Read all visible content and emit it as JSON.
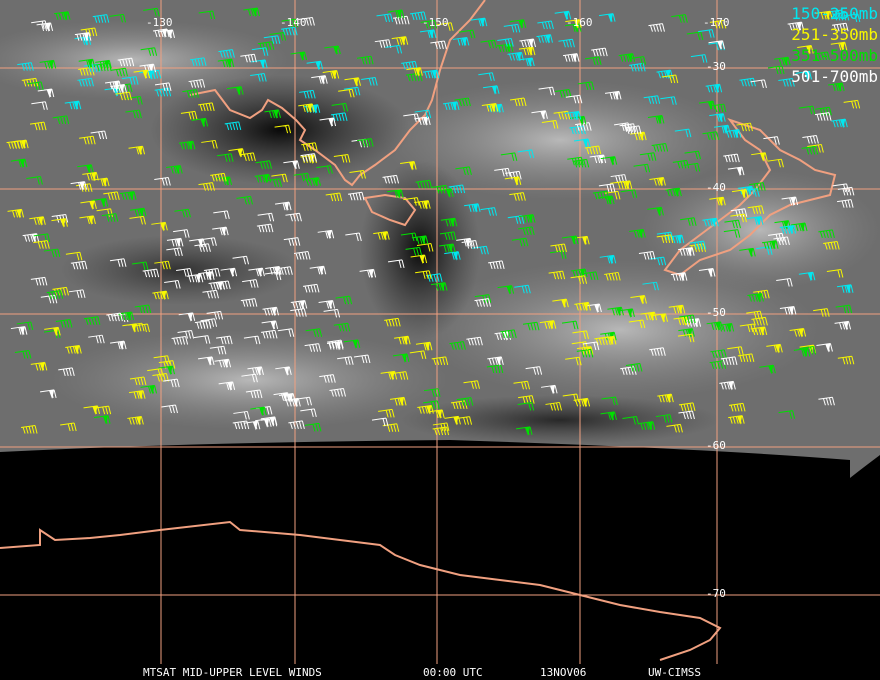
{
  "map": {
    "lon_labels": [
      "-130",
      "-140",
      "-150",
      "-160",
      "-170"
    ],
    "lat_labels": [
      "-30",
      "-40",
      "-50",
      "-60",
      "-70"
    ],
    "colors": {
      "background_clouds": "#7a7a7a",
      "space": "#000000",
      "coastline": "#f0a080",
      "grid": "#f0a080"
    }
  },
  "legend": [
    {
      "label": "150-250mb",
      "color": "#00e8f0"
    },
    {
      "label": "251-350mb",
      "color": "#f8f800"
    },
    {
      "label": "351-500mb",
      "color": "#00e000"
    },
    {
      "label": "501-700mb",
      "color": "#ffffff"
    }
  ],
  "footer": {
    "product": "MTSAT MID-UPPER LEVEL WINDS",
    "time": "00:00 UTC",
    "date": "13NOV06",
    "source": "UW-CIMSS"
  }
}
